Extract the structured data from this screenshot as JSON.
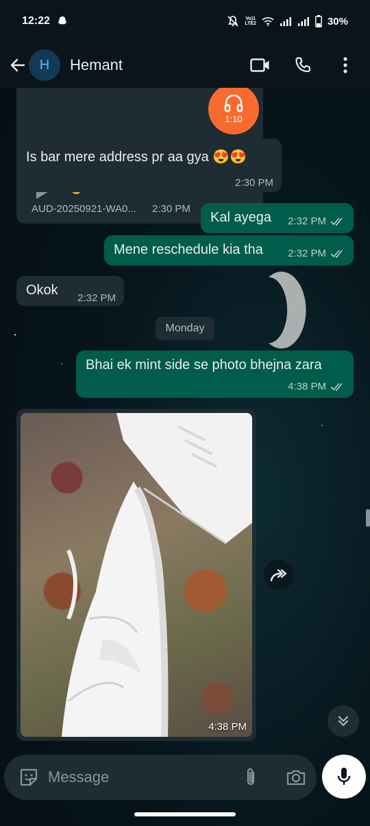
{
  "status_bar": {
    "time": "12:22",
    "volte_top": "Vo)1",
    "volte_bottom": "LTE2",
    "battery": "30%"
  },
  "header": {
    "avatar_initial": "H",
    "contact_name": "Hemant"
  },
  "messages": {
    "audio": {
      "filename": "AUD-20250921-WA0...",
      "time": "2:30 PM",
      "duration": "1:10"
    },
    "m1": {
      "text": "Is bar mere address pr aa gya 😍😍",
      "time": "2:30 PM"
    },
    "m2": {
      "text": "Kal ayega",
      "time": "2:32 PM"
    },
    "m3": {
      "text": "Mene reschedule kia tha",
      "time": "2:32 PM"
    },
    "m4": {
      "text": "Okok",
      "time": "2:32 PM"
    },
    "date_chip": "Monday",
    "m5": {
      "text": "Bhai ek mint side se photo bhejna zara",
      "time": "4:38 PM"
    },
    "photo": {
      "time": "4:38 PM"
    }
  },
  "composer": {
    "placeholder": "Message"
  },
  "colors": {
    "outgoing": "#005c4b",
    "incoming": "#1f2c33",
    "accent_orange": "#f86b2f"
  }
}
